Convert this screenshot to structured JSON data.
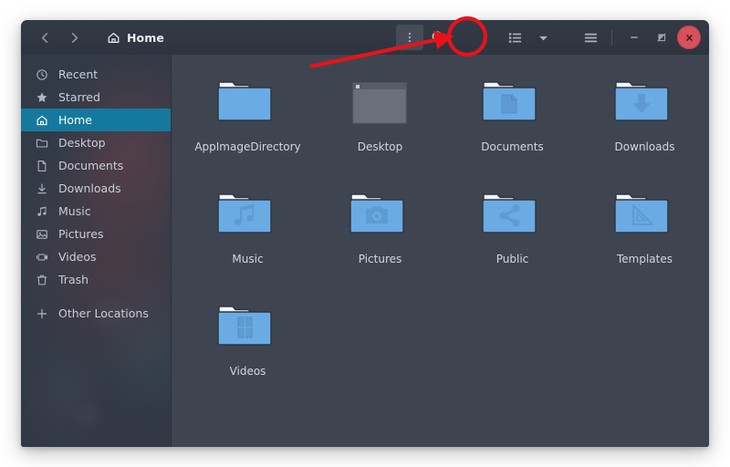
{
  "window": {
    "title": "Home",
    "nav": {
      "back_label": "Back",
      "forward_label": "Forward",
      "back_icon": "chevron-left-icon",
      "forward_icon": "chevron-right-icon"
    },
    "path_bar": {
      "icon": "home-icon",
      "label": "Home"
    },
    "toolbar": {
      "items": [
        {
          "name": "options-menu",
          "icon": "vertical-dots-icon",
          "label": "Options",
          "pressed": true
        },
        {
          "name": "search",
          "icon": "search-icon",
          "label": "Search",
          "pressed": false
        },
        {
          "name": "view-list",
          "icon": "list-view-icon",
          "label": "List view",
          "pressed": false
        },
        {
          "name": "view-options",
          "icon": "chevron-down-icon",
          "label": "View options",
          "pressed": false
        },
        {
          "name": "main-menu",
          "icon": "hamburger-menu-icon",
          "label": "Menu",
          "pressed": false
        }
      ]
    },
    "controls": {
      "minimize": {
        "icon": "minimize-icon",
        "label": "Minimize"
      },
      "maximize": {
        "icon": "maximize-icon",
        "label": "Maximize"
      },
      "close": {
        "icon": "close-icon",
        "label": "Close"
      }
    }
  },
  "sidebar": {
    "items": [
      {
        "label": "Recent",
        "icon": "clock-icon",
        "active": false
      },
      {
        "label": "Starred",
        "icon": "star-icon",
        "active": false
      },
      {
        "label": "Home",
        "icon": "home-icon",
        "active": true
      },
      {
        "label": "Desktop",
        "icon": "folder-icon",
        "active": false
      },
      {
        "label": "Documents",
        "icon": "document-icon",
        "active": false
      },
      {
        "label": "Downloads",
        "icon": "download-icon",
        "active": false
      },
      {
        "label": "Music",
        "icon": "music-note-icon",
        "active": false
      },
      {
        "label": "Pictures",
        "icon": "image-icon",
        "active": false
      },
      {
        "label": "Videos",
        "icon": "video-camera-icon",
        "active": false
      },
      {
        "label": "Trash",
        "icon": "trash-icon",
        "active": false
      }
    ],
    "other": {
      "label": "Other Locations",
      "icon": "plus-icon"
    }
  },
  "main": {
    "files": [
      {
        "label": "AppImageDirectory",
        "icon": "folder-plain-icon",
        "type": "folder"
      },
      {
        "label": "Desktop",
        "icon": "desktop-preview-icon",
        "type": "desktop"
      },
      {
        "label": "Documents",
        "icon": "folder-documents-icon",
        "type": "folder"
      },
      {
        "label": "Downloads",
        "icon": "folder-downloads-icon",
        "type": "folder"
      },
      {
        "label": "Music",
        "icon": "folder-music-icon",
        "type": "folder"
      },
      {
        "label": "Pictures",
        "icon": "folder-pictures-icon",
        "type": "folder"
      },
      {
        "label": "Public",
        "icon": "folder-public-icon",
        "type": "folder"
      },
      {
        "label": "Templates",
        "icon": "folder-templates-icon",
        "type": "folder"
      },
      {
        "label": "Videos",
        "icon": "folder-videos-icon",
        "type": "folder"
      }
    ]
  },
  "annotation": {
    "highlight_target": "search-icon",
    "shape": "circle-with-arrow",
    "color": "#e8131a"
  },
  "colors": {
    "accent": "#15799e",
    "header_bg": "#2e343f",
    "sidebar_bg": "#343b48",
    "content_bg": "#3f4550",
    "folder_blue": "#6aabe4",
    "close_red": "#d8505a",
    "annotation_red": "#e8131a",
    "label_text": "#d2d6dd"
  }
}
